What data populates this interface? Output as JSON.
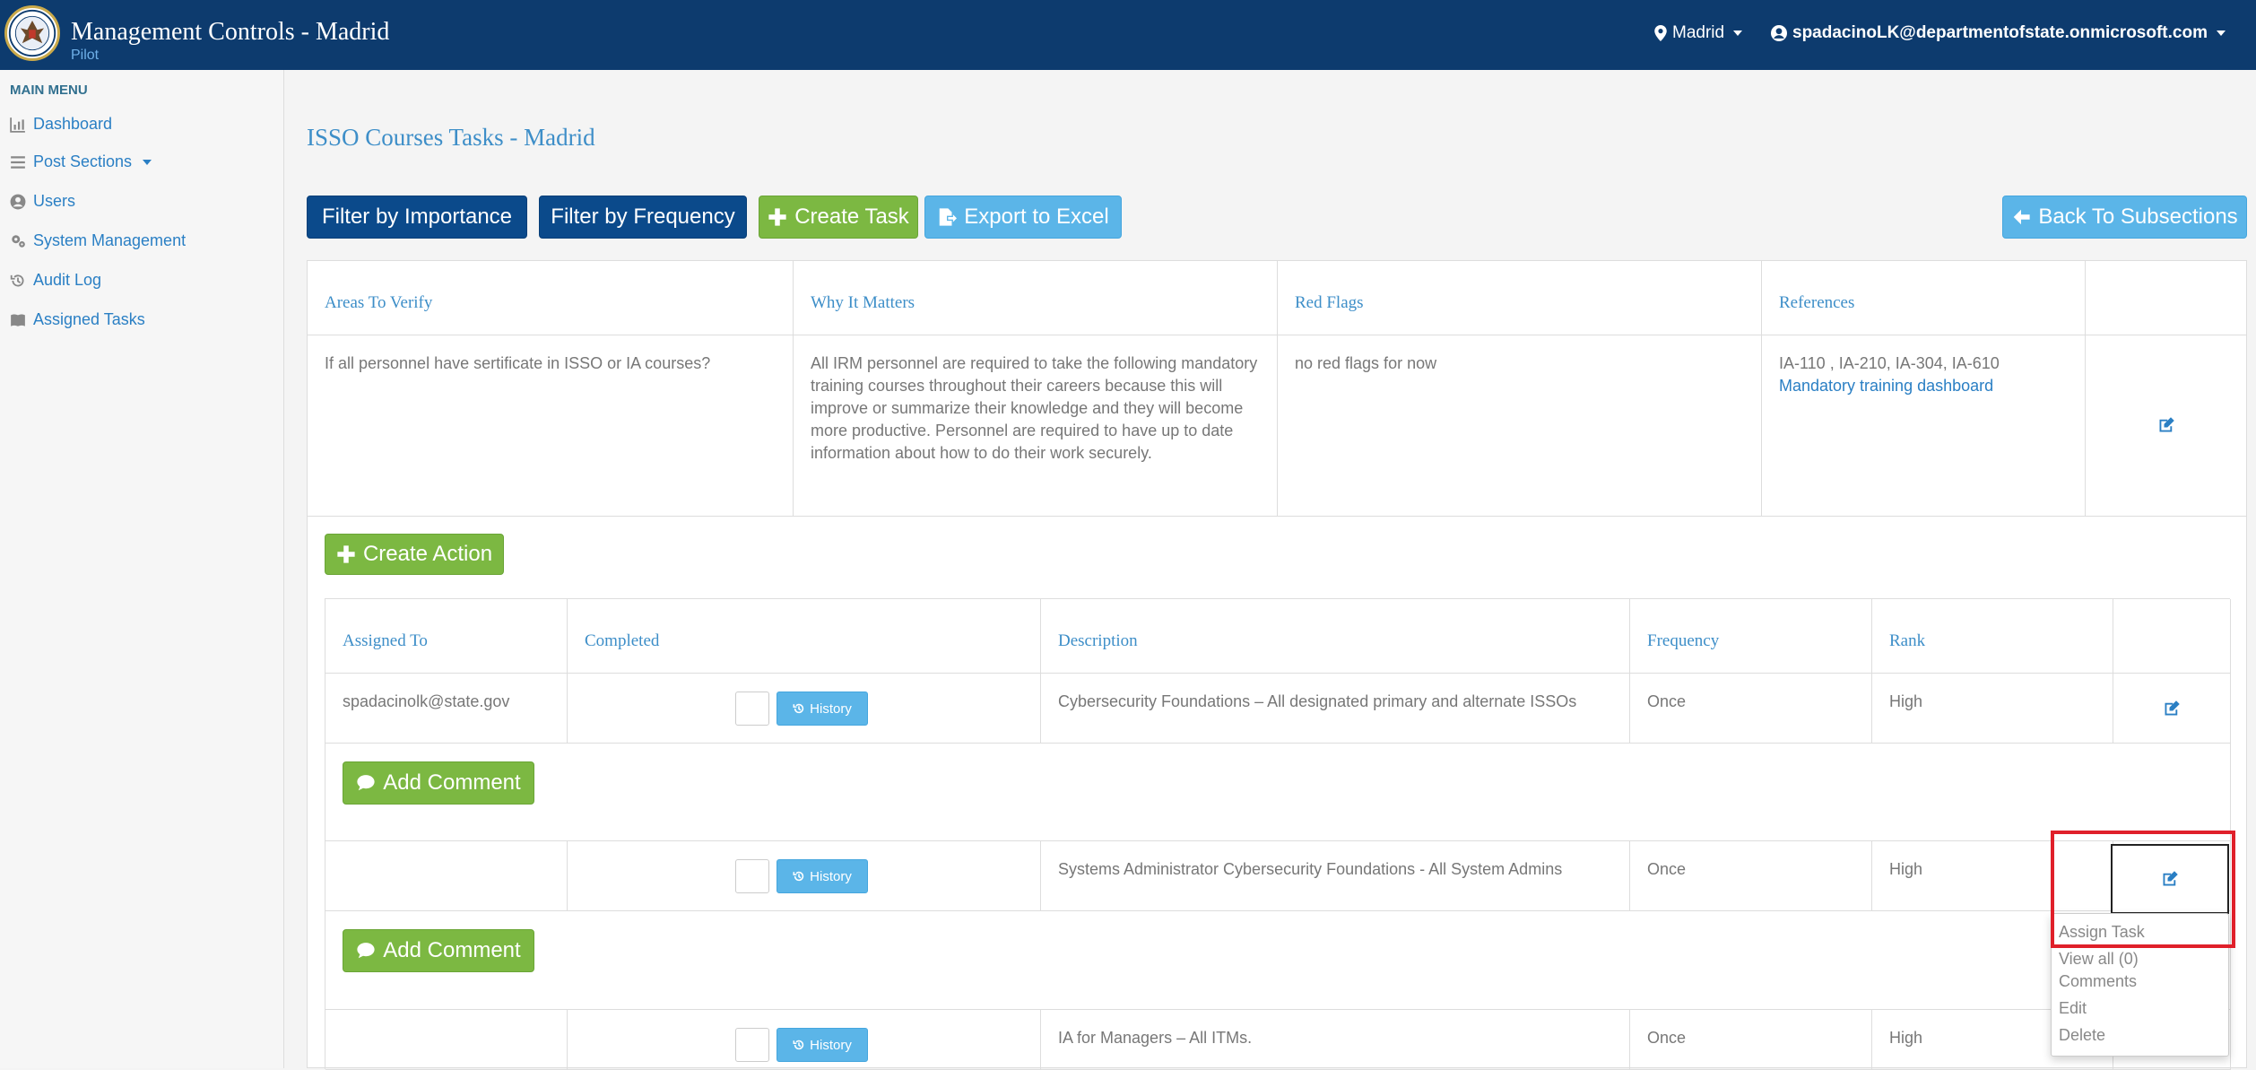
{
  "header": {
    "title": "Management Controls - Madrid",
    "subtitle": "Pilot",
    "location": "Madrid",
    "user": "spadacinoLK@departmentofstate.onmicrosoft.com"
  },
  "sidebar": {
    "heading": "MAIN MENU",
    "items": [
      {
        "label": "Dashboard",
        "icon": "bar-chart-icon"
      },
      {
        "label": "Post Sections",
        "icon": "list-icon"
      },
      {
        "label": "Users",
        "icon": "user-circle-icon"
      },
      {
        "label": "System Management",
        "icon": "gears-icon"
      },
      {
        "label": "Audit Log",
        "icon": "history-icon"
      },
      {
        "label": "Assigned Tasks",
        "icon": "book-icon"
      }
    ]
  },
  "page": {
    "title": "ISSO Courses Tasks - Madrid"
  },
  "toolbar": {
    "filter_importance": "Filter by Importance",
    "filter_frequency": "Filter by Frequency",
    "create_task": "Create Task",
    "export_excel": "Export to Excel",
    "back": "Back To Subsections"
  },
  "task_table": {
    "headers": [
      "Areas To Verify",
      "Why It Matters",
      "Red Flags",
      "References"
    ],
    "row": {
      "area": "If all personnel have sertificate in ISSO or IA courses?",
      "why": "All IRM personnel are required to take the following mandatory training courses throughout their careers because this will improve or summarize their knowledge and they will become more productive. Personnel are required to have up to date information about how to do their work securely.",
      "red_flags": "no red flags for now",
      "references_text": "IA-110 , IA-210, IA-304, IA-610",
      "references_link": "Mandatory training dashboard"
    }
  },
  "create_action": "Create Action",
  "action_table": {
    "headers": [
      "Assigned To",
      "Completed",
      "Description",
      "Frequency",
      "Rank"
    ],
    "rows": [
      {
        "assigned": "spadacinolk@state.gov",
        "description": "Cybersecurity Foundations – All designated primary and alternate ISSOs",
        "frequency": "Once",
        "rank": "High"
      },
      {
        "assigned": "",
        "description": "Systems Administrator Cybersecurity Foundations - All System Admins",
        "frequency": "Once",
        "rank": "High"
      },
      {
        "assigned": "",
        "description": "IA for Managers – All ITMs.",
        "frequency": "Once",
        "rank": "High"
      }
    ],
    "history_label": "History",
    "add_comment": "Add Comment"
  },
  "dropdown": {
    "items": [
      "Assign Task",
      "View all (0)",
      "Comments",
      "Edit",
      "Delete"
    ]
  },
  "colors": {
    "header_bg": "#0d3b6e",
    "link": "#2a7fc4",
    "green": "#7cb842",
    "navy_btn": "#0b4a8b",
    "sky_btn": "#5bb5e8",
    "highlight": "#e0202a"
  }
}
